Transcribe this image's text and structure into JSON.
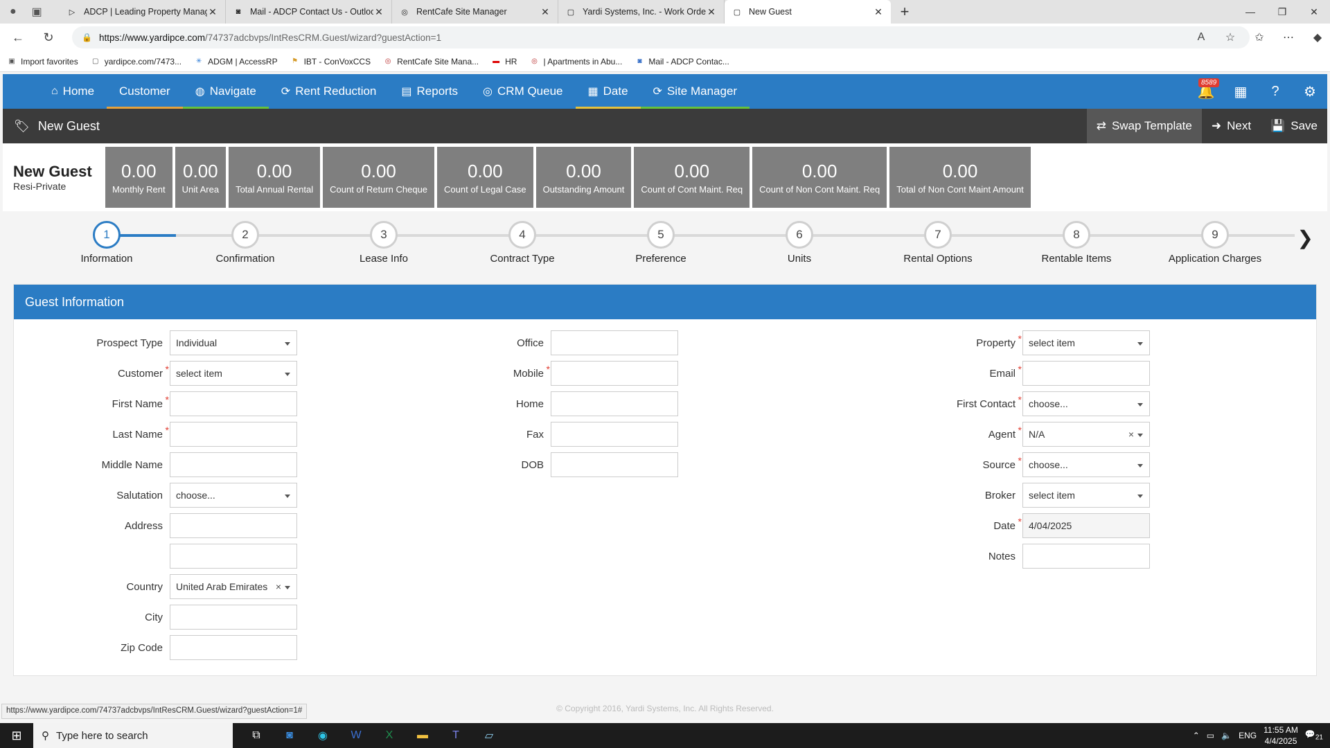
{
  "browser": {
    "tabs": [
      {
        "title": "ADCP | Leading Property Manage",
        "icon": "play-icon"
      },
      {
        "title": "Mail - ADCP Contact Us - Outlook",
        "icon": "outlook-icon"
      },
      {
        "title": "RentCafe Site Manager",
        "icon": "rentcafe-icon"
      },
      {
        "title": "Yardi Systems, Inc. - Work Order #",
        "icon": "page-icon"
      },
      {
        "title": "New Guest",
        "icon": "page-icon"
      }
    ],
    "url_host": "https://www.yardipce.com",
    "url_path": "/74737adcbvps/IntResCRM.Guest/wizard?guestAction=1",
    "favorites": [
      "Import favorites",
      "yardipce.com/7473...",
      "ADGM | AccessRP",
      "IBT - ConVoxCCS",
      "RentCafe Site Mana...",
      "HR",
      "| Apartments in Abu...",
      "Mail - ADCP Contac..."
    ]
  },
  "nav": {
    "items": [
      {
        "label": "Home",
        "icon": "home-icon",
        "underline": "#2b7cc4"
      },
      {
        "label": "Customer",
        "icon": "",
        "underline": "#e6a23c"
      },
      {
        "label": "Navigate",
        "icon": "compass-icon",
        "underline": "#67c23a"
      },
      {
        "label": "Rent Reduction",
        "icon": "refresh-icon",
        "underline": "#2b7cc4"
      },
      {
        "label": "Reports",
        "icon": "document-icon",
        "underline": "#2b7cc4"
      },
      {
        "label": "CRM Queue",
        "icon": "support-icon",
        "underline": "#2b7cc4"
      },
      {
        "label": "Date",
        "icon": "calendar-icon",
        "underline": "#e6c23c"
      },
      {
        "label": "Site Manager",
        "icon": "refresh-icon",
        "underline": "#67c23a"
      }
    ],
    "notification_count": "8589"
  },
  "titlebar": {
    "title": "New Guest",
    "swap": "Swap Template",
    "next": "Next",
    "save": "Save"
  },
  "guest": {
    "name": "New Guest",
    "type": "Resi-Private"
  },
  "stats": [
    {
      "value": "0.00",
      "label": "Monthly Rent"
    },
    {
      "value": "0.00",
      "label": "Unit Area"
    },
    {
      "value": "0.00",
      "label": "Total Annual Rental"
    },
    {
      "value": "0.00",
      "label": "Count of Return Cheque"
    },
    {
      "value": "0.00",
      "label": "Count of Legal Case"
    },
    {
      "value": "0.00",
      "label": "Outstanding Amount"
    },
    {
      "value": "0.00",
      "label": "Count of Cont Maint. Req"
    },
    {
      "value": "0.00",
      "label": "Count of Non Cont Maint. Req"
    },
    {
      "value": "0.00",
      "label": "Total of Non Cont Maint Amount"
    }
  ],
  "wizard": {
    "steps": [
      {
        "num": "1",
        "label": "Information"
      },
      {
        "num": "2",
        "label": "Confirmation"
      },
      {
        "num": "3",
        "label": "Lease Info"
      },
      {
        "num": "4",
        "label": "Contract Type"
      },
      {
        "num": "5",
        "label": "Preference"
      },
      {
        "num": "6",
        "label": "Units"
      },
      {
        "num": "7",
        "label": "Rental Options"
      },
      {
        "num": "8",
        "label": "Rentable Items"
      },
      {
        "num": "9",
        "label": "Application Charges"
      }
    ],
    "active_step": 1
  },
  "panel": {
    "title": "Guest Information",
    "col1": [
      {
        "label": "Prospect Type",
        "value": "Individual",
        "kind": "select",
        "required": false
      },
      {
        "label": "Customer",
        "value": "select item",
        "kind": "select",
        "required": true
      },
      {
        "label": "First Name",
        "value": "",
        "kind": "text",
        "required": true
      },
      {
        "label": "Last Name",
        "value": "",
        "kind": "text",
        "required": true
      },
      {
        "label": "Middle Name",
        "value": "",
        "kind": "text",
        "required": false
      },
      {
        "label": "Salutation",
        "value": "choose...",
        "kind": "select",
        "required": false
      },
      {
        "label": "Address",
        "value": "",
        "kind": "text",
        "required": false
      },
      {
        "label": "",
        "value": "",
        "kind": "text",
        "required": false
      },
      {
        "label": "Country",
        "value": "United Arab Emirates",
        "kind": "select-clear",
        "required": false
      },
      {
        "label": "City",
        "value": "",
        "kind": "text",
        "required": false
      },
      {
        "label": "Zip Code",
        "value": "",
        "kind": "text",
        "required": false
      }
    ],
    "col2": [
      {
        "label": "Office",
        "value": "",
        "kind": "text",
        "required": false
      },
      {
        "label": "Mobile",
        "value": "",
        "kind": "text",
        "required": true
      },
      {
        "label": "Home",
        "value": "",
        "kind": "text",
        "required": false
      },
      {
        "label": "Fax",
        "value": "",
        "kind": "text",
        "required": false
      },
      {
        "label": "DOB",
        "value": "",
        "kind": "text",
        "required": false
      }
    ],
    "col3": [
      {
        "label": "Property",
        "value": "select item",
        "kind": "select",
        "required": true
      },
      {
        "label": "Email",
        "value": "",
        "kind": "text",
        "required": true
      },
      {
        "label": "First Contact",
        "value": "choose...",
        "kind": "select",
        "required": true
      },
      {
        "label": "Agent",
        "value": "N/A",
        "kind": "select-clear",
        "required": true
      },
      {
        "label": "Source",
        "value": "choose...",
        "kind": "select",
        "required": true
      },
      {
        "label": "Broker",
        "value": "select item",
        "kind": "select",
        "required": false
      },
      {
        "label": "Date",
        "value": "4/04/2025",
        "kind": "disabled",
        "required": true
      },
      {
        "label": "Notes",
        "value": "",
        "kind": "text",
        "required": false
      }
    ]
  },
  "footer": {
    "copyright": "© Copyright 2016, Yardi Systems, Inc. All Rights Reserved.",
    "status_url": "https://www.yardipce.com/74737adcbvps/IntResCRM.Guest/wizard?guestAction=1#"
  },
  "taskbar": {
    "search_placeholder": "Type here to search",
    "lang": "ENG",
    "time": "11:55 AM",
    "date": "4/4/2025",
    "notif": "21"
  }
}
